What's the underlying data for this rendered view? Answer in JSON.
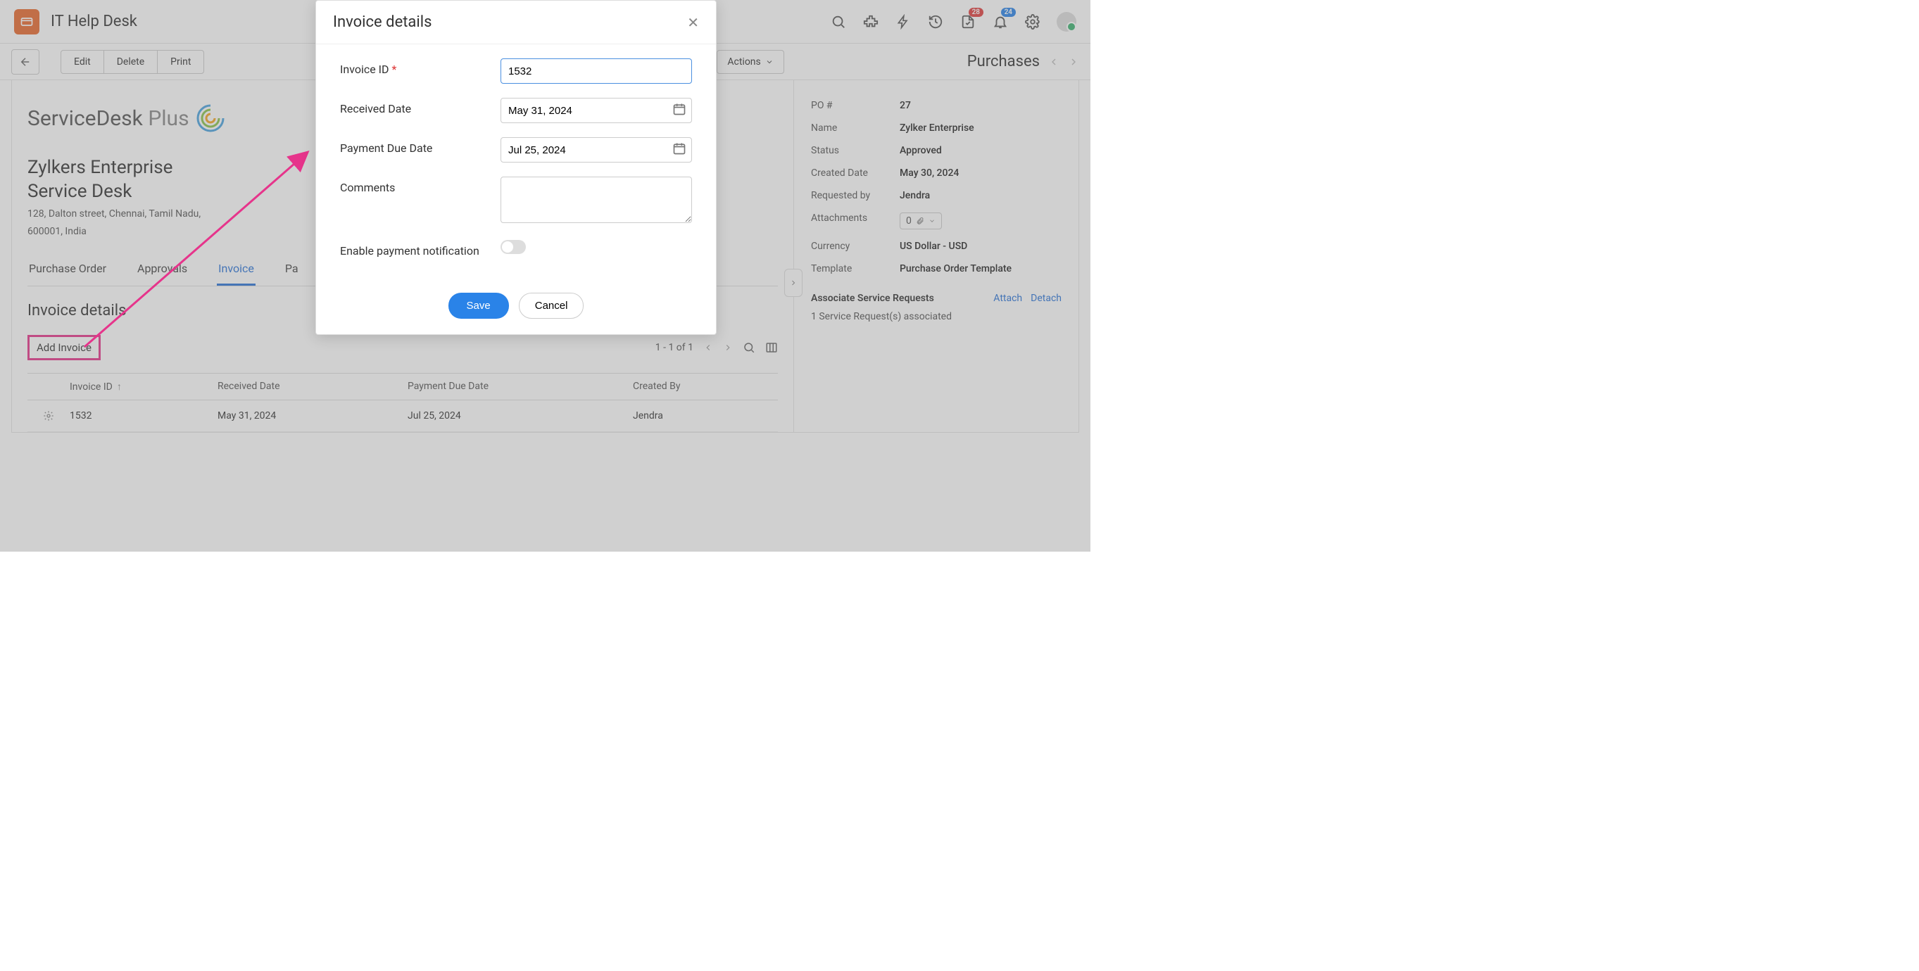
{
  "header": {
    "app_title": "IT Help Desk",
    "badges": {
      "notif_request": "28",
      "notif_bell": "24"
    }
  },
  "actionbar": {
    "edit": "Edit",
    "delete": "Delete",
    "print": "Print",
    "actions": "Actions",
    "purchases": "Purchases"
  },
  "org": {
    "logo_main": "ServiceDesk ",
    "logo_suffix": "Plus",
    "name_line1": "Zylkers Enterprise",
    "name_line2": "Service Desk",
    "addr_line1": "128, Dalton street, Chennai, Tamil Nadu,",
    "addr_line2": "600001, India"
  },
  "tabs": {
    "t1": "Purchase Order",
    "t2": "Approvals",
    "t3": "Invoice",
    "t4": "Pa"
  },
  "section": {
    "title": "Invoice details"
  },
  "toolbar": {
    "add_invoice": "Add Invoice",
    "range": "1 - 1 of 1"
  },
  "table": {
    "cols": {
      "id": "Invoice ID",
      "received": "Received Date",
      "due": "Payment Due Date",
      "created_by": "Created By"
    },
    "rows": [
      {
        "id": "1532",
        "received": "May 31, 2024",
        "due": "Jul 25, 2024",
        "created_by": "Jendra"
      }
    ]
  },
  "side": {
    "po_num_label": "PO #",
    "po_num": "27",
    "name_label": "Name",
    "name": "Zylker Enterprise",
    "status_label": "Status",
    "status": "Approved",
    "created_label": "Created Date",
    "created": "May 30, 2024",
    "req_label": "Requested by",
    "req": "Jendra",
    "attach_label": "Attachments",
    "attach_count": "0",
    "currency_label": "Currency",
    "currency": "US Dollar - USD",
    "template_label": "Template",
    "template": "Purchase Order Template",
    "assoc_title": "Associate Service Requests",
    "attach_link": "Attach",
    "detach_link": "Detach",
    "assoc_sub": "1 Service Request(s) associated"
  },
  "modal": {
    "title": "Invoice details",
    "fields": {
      "invoice_id_label": "Invoice ID",
      "invoice_id_value": "1532",
      "received_label": "Received Date",
      "received_value": "May 31, 2024",
      "due_label": "Payment Due Date",
      "due_value": "Jul 25, 2024",
      "comments_label": "Comments",
      "notify_label": "Enable payment notification"
    },
    "save": "Save",
    "cancel": "Cancel"
  }
}
